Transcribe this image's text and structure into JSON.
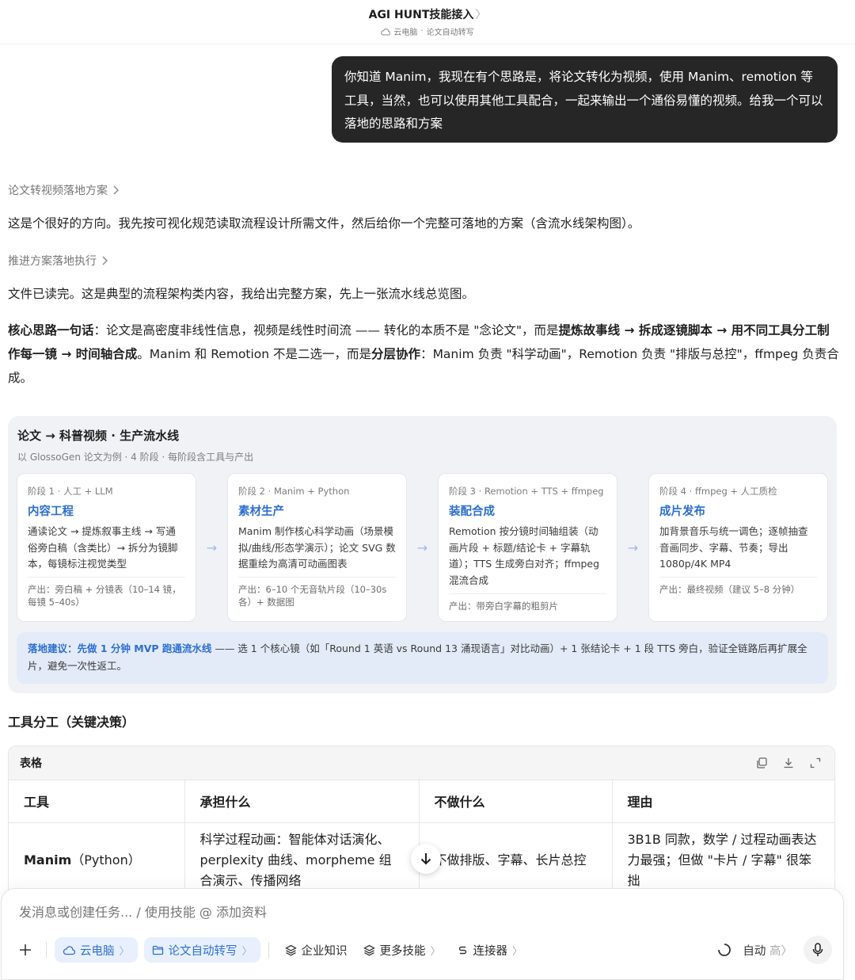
{
  "header": {
    "title": "AGI HUNT技能接入",
    "title_chevron": "〉",
    "subtitle_env": "云电脑",
    "subtitle_sep": " · ",
    "subtitle_task": "论文自动转写"
  },
  "user_message": "你知道 Manim，我现在有个思路是，将论文转化为视频，使用 Manim、remotion 等工具，当然，也可以使用其他工具配合，一起来输出一个通俗易懂的视频。给我一个可以落地的思路和方案",
  "assistant": {
    "step1_label": "论文转视频落地方案",
    "para1": "这是个很好的方向。我先按可视化规范读取流程设计所需文件，然后给你一个完整可落地的方案（含流水线架构图）。",
    "step2_label": "推进方案落地执行",
    "para2": "文件已读完。这是典型的流程架构类内容，我给出完整方案，先上一张流水线总览图。",
    "core": {
      "b1": "核心思路一句话",
      "t1": "：论文是高密度非线性信息，视频是线性时间流 —— 转化的本质不是 \"念论文\"，而是",
      "b2": "提炼故事线 → 拆成逐镜脚本 → 用不同工具分工制作每一镜 → 时间轴合成",
      "t2": "。Manim 和 Remotion 不是二选一，而是",
      "b3": "分层协作",
      "t3": "：Manim 负责 \"科学动画\"，Remotion 负责 \"排版与总控\"，ffmpeg 负责合成。"
    }
  },
  "pipeline": {
    "title": "论文 → 科普视频 · 生产流水线",
    "subtitle": "以 GlossoGen 论文为例 · 4 阶段 · 每阶段含工具与产出",
    "arrow": "→",
    "stages": [
      {
        "label": "阶段 1 · 人工 + LLM",
        "name": "内容工程",
        "desc": "通读论文 → 提炼叙事主线 → 写通俗旁白稿（含类比）→ 拆分为镜脚本，每镜标注视觉类型",
        "output": "产出：旁白稿 + 分镜表（10–14 镜，每镜 5–40s）"
      },
      {
        "label": "阶段 2 · Manim + Python",
        "name": "素材生产",
        "desc": "Manim 制作核心科学动画（场景模拟/曲线/形态学演示）；论文 SVG 数据重绘为高清可动画图表",
        "output": "产出：6–10 个无音轨片段（10–30s 各）+ 数据图"
      },
      {
        "label": "阶段 3 · Remotion + TTS + ffmpeg",
        "name": "装配合成",
        "desc": "Remotion 按分镜时间轴组装（动画片段 + 标题/结论卡 + 字幕轨道）；TTS 生成旁白对齐；ffmpeg 混流合成",
        "output": "产出：带旁白字幕的粗剪片"
      },
      {
        "label": "阶段 4 · ffmpeg + 人工质检",
        "name": "成片发布",
        "desc": "加背景音乐与统一调色；逐帧抽查音画同步、字幕、节奏；导出 1080p/4K MP4",
        "output": "产出：最终视频（建议 5–8 分钟）"
      }
    ],
    "advice_bold": "落地建议：先做 1 分钟 MVP 跑通流水线",
    "advice_text": " —— 选 1 个核心镜（如「Round 1 英语 vs Round 13 涌现语言」对比动画）+ 1 张结论卡 + 1 段 TTS 旁白，验证全链路后再扩展全片，避免一次性返工。"
  },
  "section_heading": "工具分工（关键决策）",
  "table": {
    "label": "表格",
    "headers": [
      "工具",
      "承担什么",
      "不做什么",
      "理由"
    ],
    "rows": [
      {
        "tool_bold": "Manim",
        "tool_rest": "（Python）",
        "does": "科学过程动画：智能体对话演化、perplexity 曲线、morpheme 组合演示、传播网络",
        "not_does": "不做排版、字幕、长片总控",
        "reason": "3B1B 同款，数学 / 过程动画表达力最强；但做 \"卡片 / 字幕\" 很笨拙"
      }
    ]
  },
  "composer": {
    "placeholder": "发消息或创建任务... / 使用技能 @ 添加资料",
    "chip_cloud": "云电脑",
    "chip_task": "论文自动转写",
    "chip_knowledge": "企业知识",
    "chip_skills": "更多技能",
    "chip_connector": "连接器",
    "chevron": "〉",
    "mode": "自动",
    "mode_level": "高"
  },
  "colors": {
    "accent": "#2d6fd0",
    "bubble": "#262626",
    "card_bg": "#f1f2f5",
    "advice_bg": "#e3ebf8"
  }
}
